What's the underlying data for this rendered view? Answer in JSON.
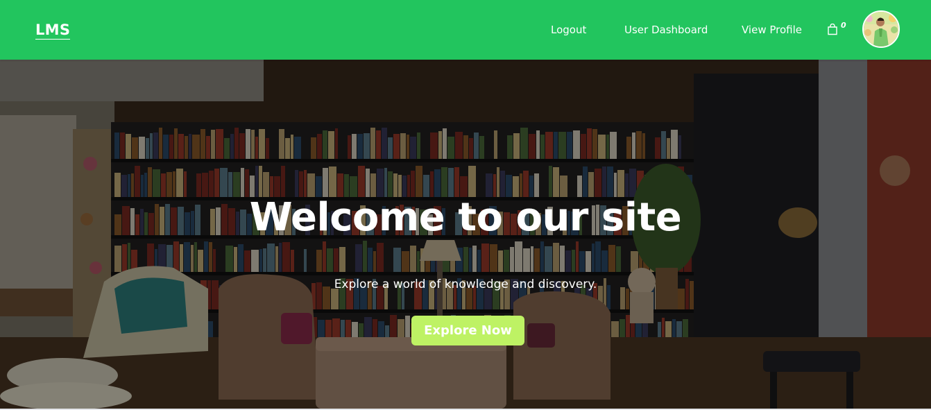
{
  "navbar": {
    "brand": "LMS",
    "links": [
      {
        "label": "Logout"
      },
      {
        "label": "User Dashboard"
      },
      {
        "label": "View Profile"
      }
    ],
    "cart": {
      "icon": "shopping-bag-icon",
      "count": "0"
    },
    "avatar": {
      "icon": "user-avatar"
    }
  },
  "hero": {
    "title": "Welcome to our site",
    "subtitle": "Explore a world of knowledge and discovery.",
    "cta_label": "Explore Now"
  },
  "colors": {
    "navbar": "#22c55e",
    "cta": "#bef264",
    "text": "#ffffff"
  }
}
